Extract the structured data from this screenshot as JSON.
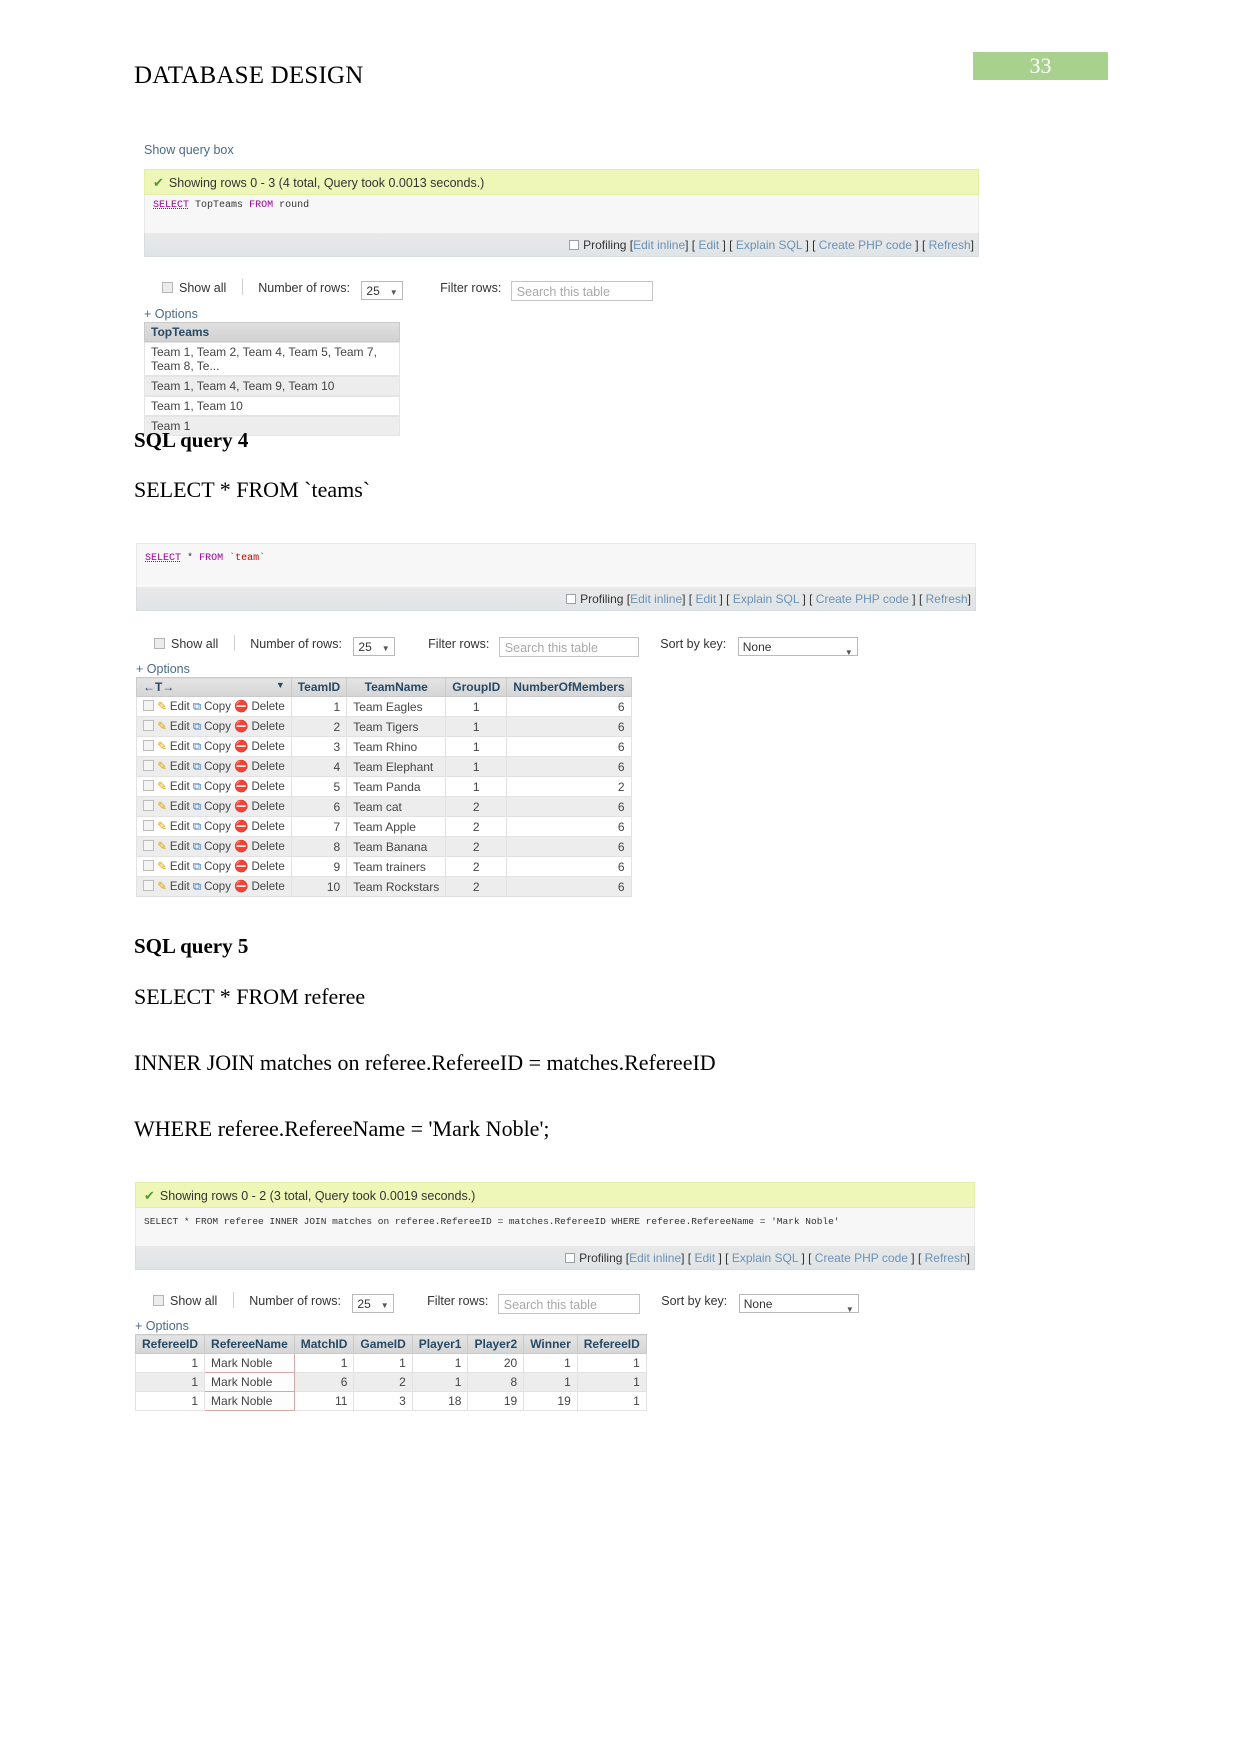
{
  "page": {
    "header_title": "DATABASE DESIGN",
    "page_number": "33"
  },
  "block1": {
    "show_query_box": "Show query box",
    "status": "Showing rows 0 - 3 (4 total, Query took 0.0013 seconds.)",
    "sql": {
      "kw1": "SELECT",
      "field": "TopTeams",
      "kw2": "FROM",
      "table": "round"
    },
    "actions": {
      "profiling": "Profiling",
      "edit_inline": "Edit inline",
      "edit": "Edit",
      "explain": "Explain SQL",
      "create_php": "Create PHP code",
      "refresh": "Refresh"
    },
    "controls": {
      "show_all": "Show all",
      "number_of_rows_label": "Number of rows:",
      "number_of_rows_value": "25",
      "filter_rows_label": "Filter rows:",
      "filter_placeholder": "Search this table",
      "options": "+ Options"
    },
    "table": {
      "header": "TopTeams",
      "rows": [
        "Team 1, Team 2, Team 4, Team 5, Team 7, Team 8, Te...",
        "Team 1, Team 4, Team 9, Team 10",
        "Team 1, Team 10",
        "Team 1"
      ]
    }
  },
  "section4": {
    "heading": "SQL query 4",
    "query": "SELECT * FROM `teams`"
  },
  "block2": {
    "sql": {
      "kw1": "SELECT",
      "star": "*",
      "kw2": "FROM",
      "table": "`team`"
    },
    "actions": {
      "profiling": "Profiling",
      "edit_inline": "Edit inline",
      "edit": "Edit",
      "explain": "Explain SQL",
      "create_php": "Create PHP code",
      "refresh": "Refresh"
    },
    "controls": {
      "show_all": "Show all",
      "number_of_rows_label": "Number of rows:",
      "number_of_rows_value": "25",
      "filter_rows_label": "Filter rows:",
      "filter_placeholder": "Search this table",
      "sort_by_key_label": "Sort by key:",
      "sort_by_key_value": "None",
      "options": "+ Options"
    },
    "table": {
      "action_labels": {
        "edit": "Edit",
        "copy": "Copy",
        "delete": "Delete"
      },
      "columns": [
        "TeamID",
        "TeamName",
        "GroupID",
        "NumberOfMembers"
      ],
      "rows": [
        {
          "id": "1",
          "name": "Team Eagles",
          "group": "1",
          "members": "6"
        },
        {
          "id": "2",
          "name": "Team Tigers",
          "group": "1",
          "members": "6"
        },
        {
          "id": "3",
          "name": "Team Rhino",
          "group": "1",
          "members": "6"
        },
        {
          "id": "4",
          "name": "Team Elephant",
          "group": "1",
          "members": "6"
        },
        {
          "id": "5",
          "name": "Team Panda",
          "group": "1",
          "members": "2"
        },
        {
          "id": "6",
          "name": "Team cat",
          "group": "2",
          "members": "6"
        },
        {
          "id": "7",
          "name": "Team Apple",
          "group": "2",
          "members": "6"
        },
        {
          "id": "8",
          "name": "Team Banana",
          "group": "2",
          "members": "6"
        },
        {
          "id": "9",
          "name": "Team trainers",
          "group": "2",
          "members": "6"
        },
        {
          "id": "10",
          "name": "Team Rockstars",
          "group": "2",
          "members": "6"
        }
      ]
    }
  },
  "section5": {
    "heading": "SQL query 5",
    "line1": "SELECT * FROM referee",
    "line2": "INNER JOIN matches on referee.RefereeID = matches.RefereeID",
    "line3": "WHERE referee.RefereeName = 'Mark Noble';"
  },
  "block3": {
    "status": "Showing rows 0 - 2 (3 total, Query took 0.0019 seconds.)",
    "sql_text": "SELECT * FROM referee INNER JOIN matches on referee.RefereeID = matches.RefereeID WHERE referee.RefereeName = 'Mark Noble'",
    "actions": {
      "profiling": "Profiling",
      "edit_inline": "Edit inline",
      "edit": "Edit",
      "explain": "Explain SQL",
      "create_php": "Create PHP code",
      "refresh": "Refresh"
    },
    "controls": {
      "show_all": "Show all",
      "number_of_rows_label": "Number of rows:",
      "number_of_rows_value": "25",
      "filter_rows_label": "Filter rows:",
      "filter_placeholder": "Search this table",
      "sort_by_key_label": "Sort by key:",
      "sort_by_key_value": "None",
      "options": "+ Options"
    },
    "table": {
      "columns": [
        "RefereeID",
        "RefereeName",
        "MatchID",
        "GameID",
        "Player1",
        "Player2",
        "Winner",
        "RefereeID"
      ],
      "rows": [
        {
          "ref_id": "1",
          "ref_name": "Mark Noble",
          "match_id": "1",
          "game_id": "1",
          "p1": "1",
          "p2": "20",
          "winner": "1",
          "ref_id2": "1"
        },
        {
          "ref_id": "1",
          "ref_name": "Mark Noble",
          "match_id": "6",
          "game_id": "2",
          "p1": "1",
          "p2": "8",
          "winner": "1",
          "ref_id2": "1"
        },
        {
          "ref_id": "1",
          "ref_name": "Mark Noble",
          "match_id": "11",
          "game_id": "3",
          "p1": "18",
          "p2": "19",
          "winner": "19",
          "ref_id2": "1"
        }
      ]
    }
  },
  "colors": {
    "badge_green": "#a9d18e",
    "success_bg": "#eef7b8",
    "link_blue": "#4a6a8a"
  }
}
